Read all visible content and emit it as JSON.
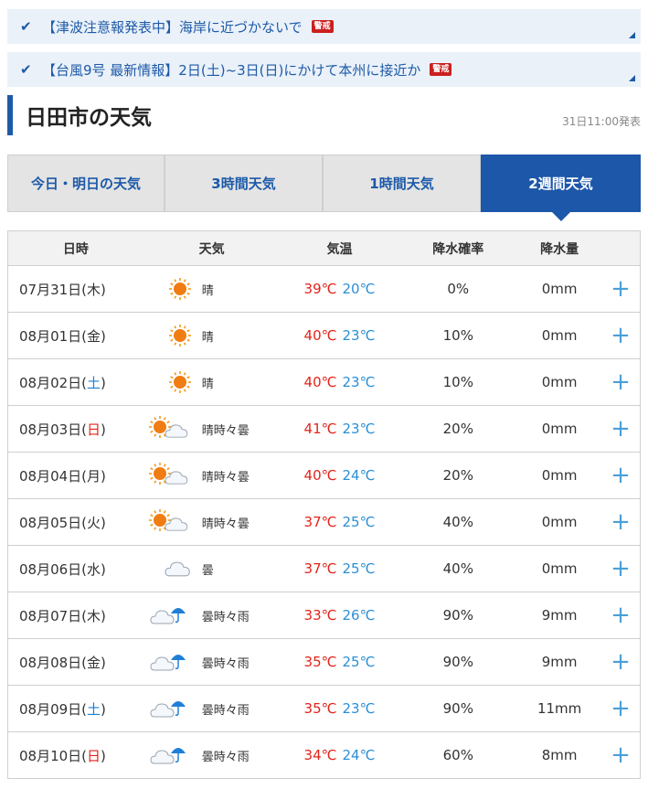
{
  "alerts": [
    {
      "text": "【津波注意報発表中】海岸に近づかないで",
      "badge": "警戒"
    },
    {
      "text": "【台風9号 最新情報】2日(土)~3日(日)にかけて本州に接近か",
      "badge": "警戒"
    }
  ],
  "page": {
    "title": "日田市の天気",
    "issued": "31日11:00発表"
  },
  "tabs": [
    {
      "label": "今日・明日の天気",
      "active": false
    },
    {
      "label": "3時間天気",
      "active": false
    },
    {
      "label": "1時間天気",
      "active": false
    },
    {
      "label": "2週間天気",
      "active": true
    }
  ],
  "table": {
    "headers": {
      "date": "日時",
      "weather": "天気",
      "temp": "気温",
      "pop": "降水確率",
      "amount": "降水量"
    },
    "plus_label": "+",
    "rows": [
      {
        "date": "07月31日(",
        "dow": "木",
        "close": ")",
        "dow_type": "weekday",
        "icon": "sunny-icon",
        "weather": "晴",
        "high": "39℃",
        "low": "20℃",
        "pop": "0%",
        "amount": "0mm"
      },
      {
        "date": "08月01日(",
        "dow": "金",
        "close": ")",
        "dow_type": "weekday",
        "icon": "sunny-icon",
        "weather": "晴",
        "high": "40℃",
        "low": "23℃",
        "pop": "10%",
        "amount": "0mm"
      },
      {
        "date": "08月02日(",
        "dow": "土",
        "close": ")",
        "dow_type": "saturday",
        "icon": "sunny-icon",
        "weather": "晴",
        "high": "40℃",
        "low": "23℃",
        "pop": "10%",
        "amount": "0mm"
      },
      {
        "date": "08月03日(",
        "dow": "日",
        "close": ")",
        "dow_type": "sunday",
        "icon": "sun-cloud-icon",
        "weather": "晴時々曇",
        "high": "41℃",
        "low": "23℃",
        "pop": "20%",
        "amount": "0mm"
      },
      {
        "date": "08月04日(",
        "dow": "月",
        "close": ")",
        "dow_type": "weekday",
        "icon": "sun-cloud-icon",
        "weather": "晴時々曇",
        "high": "40℃",
        "low": "24℃",
        "pop": "20%",
        "amount": "0mm"
      },
      {
        "date": "08月05日(",
        "dow": "火",
        "close": ")",
        "dow_type": "weekday",
        "icon": "sun-cloud-icon",
        "weather": "晴時々曇",
        "high": "37℃",
        "low": "25℃",
        "pop": "40%",
        "amount": "0mm"
      },
      {
        "date": "08月06日(",
        "dow": "水",
        "close": ")",
        "dow_type": "weekday",
        "icon": "cloudy-icon",
        "weather": "曇",
        "high": "37℃",
        "low": "25℃",
        "pop": "40%",
        "amount": "0mm"
      },
      {
        "date": "08月07日(",
        "dow": "木",
        "close": ")",
        "dow_type": "weekday",
        "icon": "cloud-umbrella-icon",
        "weather": "曇時々雨",
        "high": "33℃",
        "low": "26℃",
        "pop": "90%",
        "amount": "9mm"
      },
      {
        "date": "08月08日(",
        "dow": "金",
        "close": ")",
        "dow_type": "weekday",
        "icon": "cloud-umbrella-icon",
        "weather": "曇時々雨",
        "high": "35℃",
        "low": "25℃",
        "pop": "90%",
        "amount": "9mm"
      },
      {
        "date": "08月09日(",
        "dow": "土",
        "close": ")",
        "dow_type": "saturday",
        "icon": "cloud-umbrella-icon",
        "weather": "曇時々雨",
        "high": "35℃",
        "low": "23℃",
        "pop": "90%",
        "amount": "11mm"
      },
      {
        "date": "08月10日(",
        "dow": "日",
        "close": ")",
        "dow_type": "sunday",
        "icon": "cloud-umbrella-icon",
        "weather": "曇時々雨",
        "high": "34℃",
        "low": "24℃",
        "pop": "60%",
        "amount": "8mm"
      }
    ]
  },
  "colors": {
    "accent": "#1d57a9",
    "high_temp": "#e2231a",
    "low_temp": "#2a8fd6",
    "plus": "#4a9fd8",
    "alert_bg": "#eaf1f9"
  }
}
